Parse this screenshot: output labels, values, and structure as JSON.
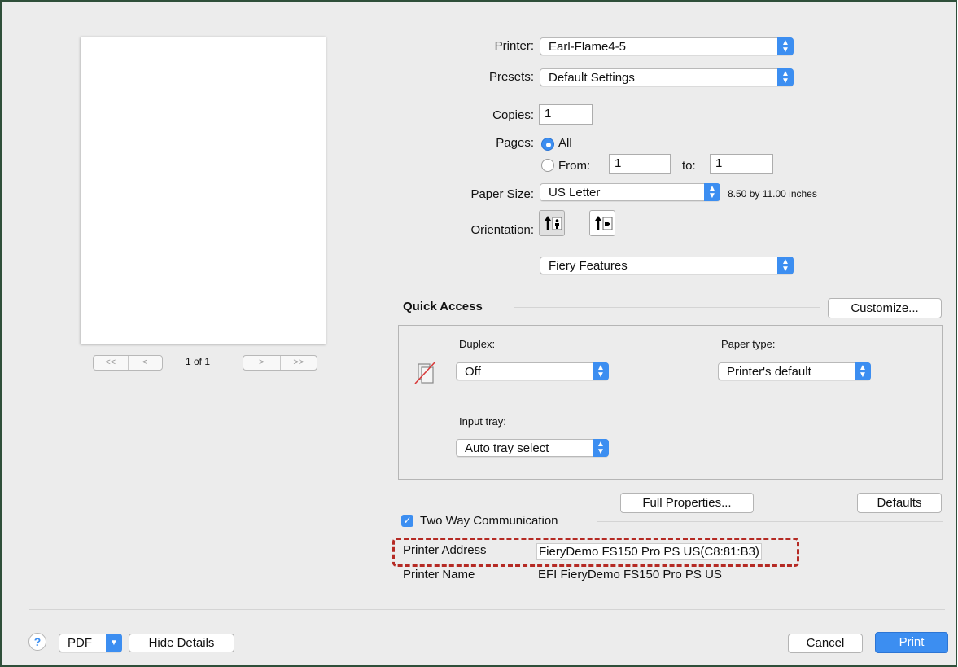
{
  "preview": {
    "page_indicator": "1 of 1",
    "first": "<<",
    "prev": "<",
    "next": ">",
    "last": ">>"
  },
  "printer": {
    "label": "Printer:",
    "value": "Earl-Flame4-5"
  },
  "presets": {
    "label": "Presets:",
    "value": "Default Settings"
  },
  "copies": {
    "label": "Copies:",
    "value": "1"
  },
  "pages": {
    "label": "Pages:",
    "all_label": "All",
    "from_label": "From:",
    "from_value": "1",
    "to_label": "to:",
    "to_value": "1",
    "selected": "All"
  },
  "paper_size": {
    "label": "Paper Size:",
    "value": "US Letter",
    "dimensions": "8.50 by 11.00 inches"
  },
  "orientation": {
    "label": "Orientation:",
    "selected": "portrait"
  },
  "section_popup": {
    "value": "Fiery Features"
  },
  "quick_access": {
    "title": "Quick Access",
    "customize_label": "Customize...",
    "duplex": {
      "label": "Duplex:",
      "value": "Off"
    },
    "paper_type": {
      "label": "Paper type:",
      "value": "Printer's default"
    },
    "input_tray": {
      "label": "Input tray:",
      "value": "Auto tray select"
    }
  },
  "full_properties_label": "Full Properties...",
  "defaults_label": "Defaults",
  "two_way": {
    "label": "Two Way Communication",
    "checked": true
  },
  "printer_address": {
    "label": "Printer Address",
    "value": "FieryDemo FS150 Pro PS US(C8:81:B3)"
  },
  "printer_name": {
    "label": "Printer Name",
    "value": "EFI FieryDemo FS150 Pro PS US"
  },
  "footer": {
    "help": "?",
    "pdf_label": "PDF",
    "hide_details_label": "Hide Details",
    "cancel_label": "Cancel",
    "print_label": "Print"
  },
  "colors": {
    "accent": "#3c8ef1",
    "highlight_dash": "#b52a24",
    "window_bg": "#ececec"
  }
}
